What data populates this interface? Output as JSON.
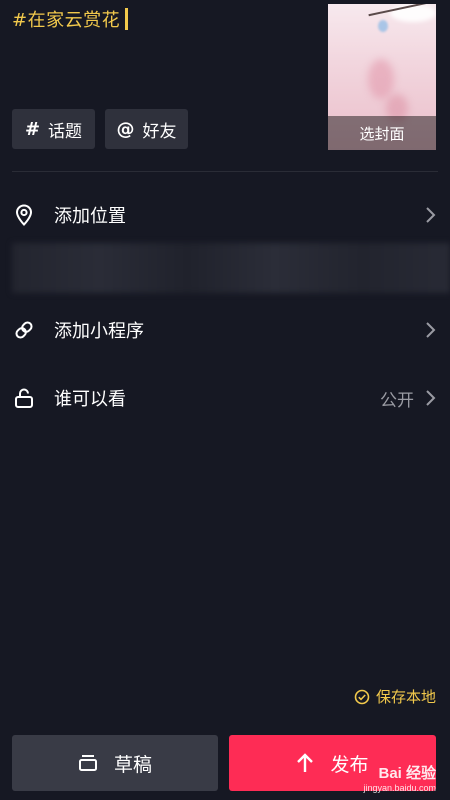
{
  "caption": {
    "text": "#在家云赏花"
  },
  "cover": {
    "label": "选封面"
  },
  "tags": {
    "topic_symbol": "#",
    "topic_label": "话题",
    "friend_symbol": "@",
    "friend_label": "好友"
  },
  "settings": {
    "location_label": "添加位置",
    "miniprogram_label": "添加小程序",
    "visibility_label": "谁可以看",
    "visibility_value": "公开"
  },
  "save_local": {
    "label": "保存本地"
  },
  "bottom": {
    "draft_label": "草稿",
    "publish_label": "发布"
  },
  "watermark": {
    "top": "Bai 经验",
    "bottom": "jingyan.baidu.com"
  },
  "colors": {
    "background": "#161823",
    "accent_yellow": "#f2c94c",
    "publish_red": "#fe2c55",
    "button_gray": "#393b46"
  }
}
